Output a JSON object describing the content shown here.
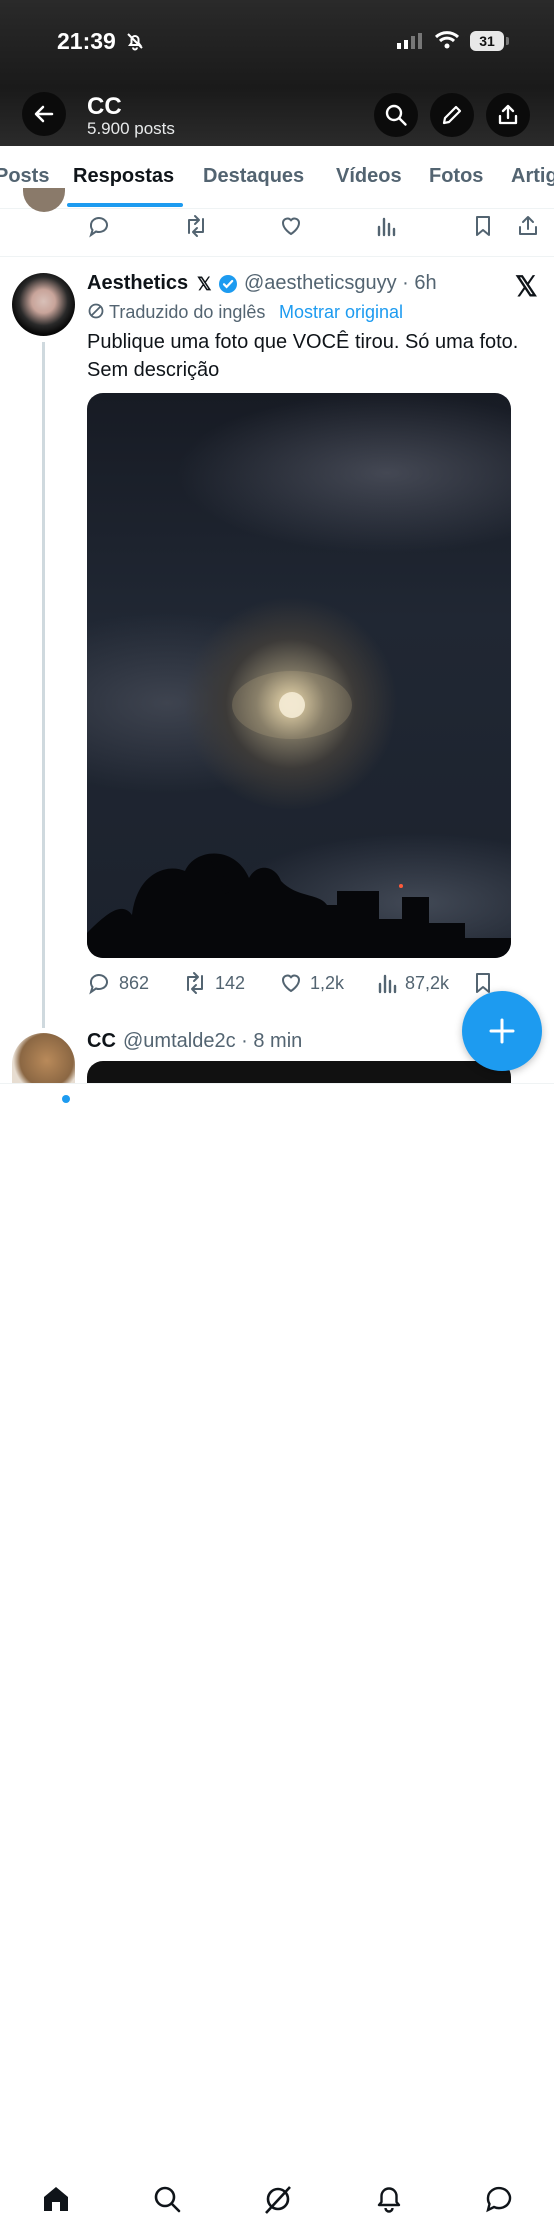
{
  "status_bar": {
    "time": "21:39",
    "battery": "31"
  },
  "header": {
    "name": "CC",
    "posts": "5.900 posts"
  },
  "tabs": [
    {
      "label": "Posts"
    },
    {
      "label": "Respostas"
    },
    {
      "label": "Destaques"
    },
    {
      "label": "Vídeos"
    },
    {
      "label": "Fotos"
    },
    {
      "label": "Artigos"
    }
  ],
  "post": {
    "author": "Aesthetics",
    "x_badge": "𝕏",
    "handle": "@aestheticsguyy · 6h",
    "translated_label": "Traduzido do inglês",
    "show_original": "Mostrar original",
    "text": "Publique uma foto que VOCÊ tirou. Só uma foto. Sem descrição",
    "stats": {
      "replies": "862",
      "reposts": "142",
      "likes": "1,2k",
      "views": "87,2k"
    }
  },
  "next_post": {
    "author": "CC",
    "handle": "@umtalde2c · 8 min"
  },
  "colors": {
    "accent": "#1d9bf0",
    "text": "#0f1419",
    "muted": "#536471"
  },
  "icons": [
    "bell-slash-icon",
    "search-icon",
    "pencil-icon",
    "share-icon",
    "reply-icon",
    "repost-icon",
    "like-icon",
    "views-icon",
    "bookmark-icon",
    "home-icon",
    "grok-icon",
    "notifications-icon",
    "messages-icon"
  ]
}
